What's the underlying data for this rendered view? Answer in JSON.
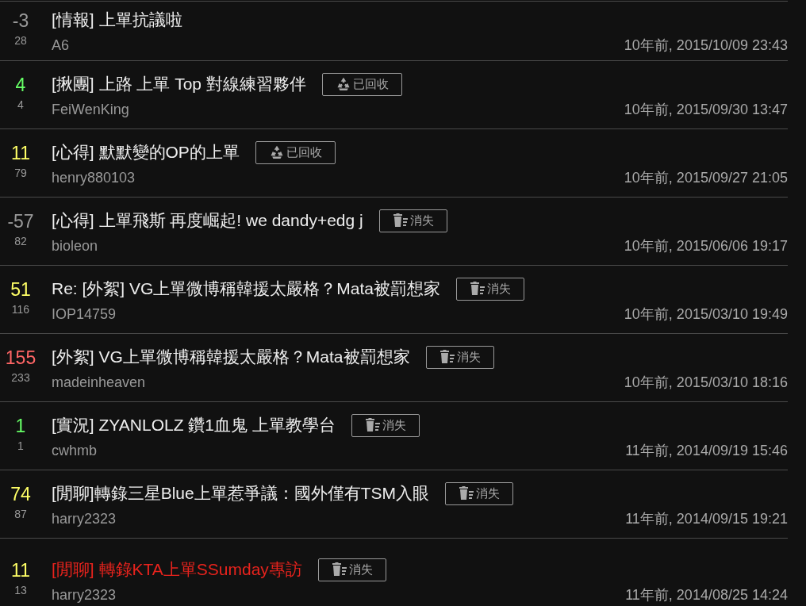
{
  "posts": [
    {
      "score": "-3",
      "color": "#999999",
      "comments": "28",
      "title": "[情報] 上單抗議啦",
      "alert": false,
      "author": "A6",
      "time": "10年前, 2015/10/09 23:43"
    },
    {
      "score": "4",
      "color": "#66ff66",
      "comments": "4",
      "title": "[揪團] 上路 上單 Top 對線練習夥伴",
      "alert": false,
      "badge": {
        "kind": "recycled",
        "label": "已回收"
      },
      "author": "FeiWenKing",
      "time": "10年前, 2015/09/30 13:47"
    },
    {
      "score": "11",
      "color": "#ffff66",
      "comments": "79",
      "title": "[心得] 默默變的OP的上單",
      "alert": false,
      "badge": {
        "kind": "recycled",
        "label": "已回收"
      },
      "author": "henry880103",
      "time": "10年前, 2015/09/27 21:05"
    },
    {
      "score": "-57",
      "color": "#999999",
      "comments": "82",
      "title": "[心得] 上單飛斯 再度崛起! we dandy+edg j",
      "alert": false,
      "badge": {
        "kind": "deleted",
        "label": "消失"
      },
      "author": "bioleon",
      "time": "10年前, 2015/06/06 19:17"
    },
    {
      "score": "51",
      "color": "#ffff66",
      "comments": "116",
      "title": "Re: [外絮] VG上單微博稱韓援太嚴格？Mata被罰想家",
      "alert": false,
      "badge": {
        "kind": "deleted",
        "label": "消失"
      },
      "author": "IOP14759",
      "time": "10年前, 2015/03/10 19:49"
    },
    {
      "score": "155",
      "color": "#ff6666",
      "comments": "233",
      "title": "[外絮] VG上單微博稱韓援太嚴格？Mata被罰想家",
      "alert": false,
      "badge": {
        "kind": "deleted",
        "label": "消失"
      },
      "author": "madeinheaven",
      "time": "10年前, 2015/03/10 18:16"
    },
    {
      "score": "1",
      "color": "#66ff66",
      "comments": "1",
      "title": "[實況] ZYANLOLZ 鑽1血鬼 上單教學台",
      "alert": false,
      "badge": {
        "kind": "deleted",
        "label": "消失"
      },
      "author": "cwhmb",
      "time": "11年前, 2014/09/19 15:46"
    },
    {
      "score": "74",
      "color": "#ffff66",
      "comments": "87",
      "title": "[閒聊]轉錄三星Blue上單惹爭議：國外僅有TSM入眼",
      "alert": false,
      "badge": {
        "kind": "deleted",
        "label": "消失"
      },
      "author": "harry2323",
      "time": "11年前, 2014/09/15 19:21"
    },
    {
      "score": "11",
      "color": "#ffff66",
      "comments": "13",
      "title": "[閒聊] 轉錄KTA上單SSumday專訪",
      "alert": true,
      "badge": {
        "kind": "deleted",
        "label": "消失"
      },
      "author": "harry2323",
      "time": "11年前, 2014/08/25 14:24"
    }
  ]
}
